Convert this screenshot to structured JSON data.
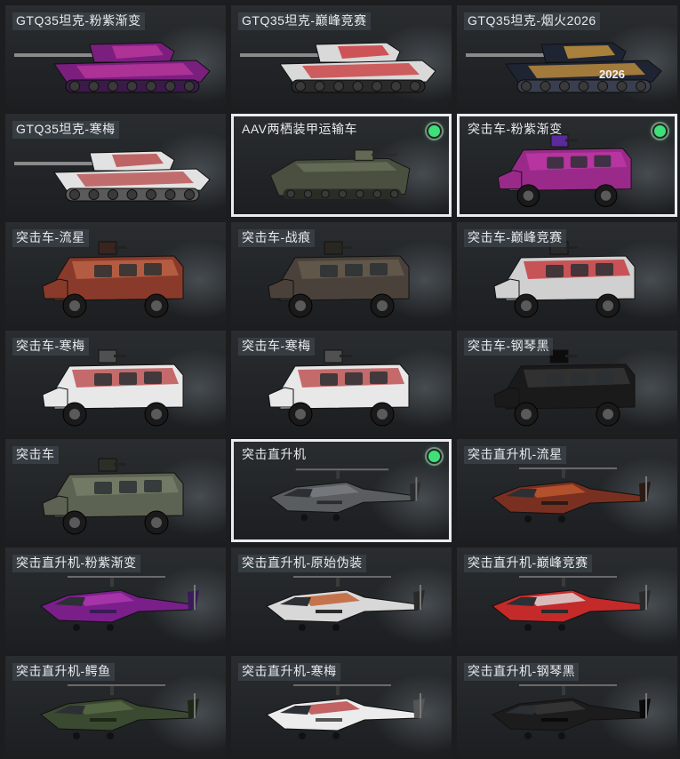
{
  "items": [
    {
      "label": "GTQ35坦克-粉紫渐变",
      "type": "tank",
      "colors": [
        "#7a1f7e",
        "#c23aa0",
        "#3a1a4a"
      ],
      "selected": false,
      "owned": false
    },
    {
      "label": "GTQ35坦克-巅峰竞赛",
      "type": "tank",
      "colors": [
        "#d9d9d9",
        "#c8262a",
        "#2a2a2a"
      ],
      "selected": false,
      "owned": false
    },
    {
      "label": "GTQ35坦克-烟火2026",
      "type": "tank",
      "colors": [
        "#1e2432",
        "#d8a040",
        "#3a3f50"
      ],
      "selected": false,
      "owned": false,
      "decal": "2026"
    },
    {
      "label": "GTQ35坦克-寒梅",
      "type": "tank",
      "colors": [
        "#e2e2e2",
        "#b33a3a",
        "#5a5a5a"
      ],
      "selected": false,
      "owned": false
    },
    {
      "label": "AAV两栖装甲运输车",
      "type": "amphib",
      "colors": [
        "#4a5040",
        "#626a55",
        "#2a2d26"
      ],
      "selected": true,
      "owned": true
    },
    {
      "label": "突击车-粉紫渐变",
      "type": "truck",
      "colors": [
        "#9a2a8a",
        "#c03aa8",
        "#5a2a9a"
      ],
      "selected": true,
      "owned": true
    },
    {
      "label": "突击车-流星",
      "type": "truck",
      "colors": [
        "#8a3a2a",
        "#c2684a",
        "#3a2420"
      ],
      "selected": false,
      "owned": false
    },
    {
      "label": "突击车-战痕",
      "type": "truck",
      "colors": [
        "#4a423a",
        "#6a5e50",
        "#2a2622"
      ],
      "selected": false,
      "owned": false
    },
    {
      "label": "突击车-巅峰竞赛",
      "type": "truck",
      "colors": [
        "#d0d0d0",
        "#c42a2e",
        "#2a2a2a"
      ],
      "selected": false,
      "owned": false
    },
    {
      "label": "突击车-寒梅",
      "type": "truck",
      "colors": [
        "#e8e8e8",
        "#b84040",
        "#505050"
      ],
      "selected": false,
      "owned": false
    },
    {
      "label": "突击车-寒梅",
      "type": "truck",
      "colors": [
        "#e8e8e8",
        "#b84040",
        "#505050"
      ],
      "selected": false,
      "owned": false
    },
    {
      "label": "突击车-钢琴黑",
      "type": "truck",
      "colors": [
        "#1a1a1a",
        "#3a3a3a",
        "#0c0c0c"
      ],
      "selected": false,
      "owned": false
    },
    {
      "label": "突击车",
      "type": "truck",
      "colors": [
        "#5c6352",
        "#7a806c",
        "#2c2f28"
      ],
      "selected": false,
      "owned": false
    },
    {
      "label": "突击直升机",
      "type": "heli",
      "colors": [
        "#5a5d60",
        "#7a7e82",
        "#2a2c2e"
      ],
      "selected": true,
      "owned": true
    },
    {
      "label": "突击直升机-流星",
      "type": "heli",
      "colors": [
        "#7a3020",
        "#c25a30",
        "#2a1a14"
      ],
      "selected": false,
      "owned": false
    },
    {
      "label": "突击直升机-粉紫渐变",
      "type": "heli",
      "colors": [
        "#7a1f8a",
        "#b03ab0",
        "#3a1a5a"
      ],
      "selected": false,
      "owned": false
    },
    {
      "label": "突击直升机-原始伪装",
      "type": "heli",
      "colors": [
        "#d8d8d8",
        "#c05a2a",
        "#2a2a2a"
      ],
      "selected": false,
      "owned": false
    },
    {
      "label": "突击直升机-巅峰竞赛",
      "type": "heli",
      "colors": [
        "#c42a2a",
        "#e0e0e0",
        "#2a2a2a"
      ],
      "selected": false,
      "owned": false
    },
    {
      "label": "突击直升机-鳄鱼",
      "type": "heli",
      "colors": [
        "#3a4a30",
        "#5a6a48",
        "#1e2618"
      ],
      "selected": false,
      "owned": false
    },
    {
      "label": "突击直升机-寒梅",
      "type": "heli",
      "colors": [
        "#ececec",
        "#b84040",
        "#555555"
      ],
      "selected": false,
      "owned": false
    },
    {
      "label": "突击直升机-钢琴黑",
      "type": "heli",
      "colors": [
        "#1c1c1c",
        "#3a3a3a",
        "#0a0a0a"
      ],
      "selected": false,
      "owned": false
    }
  ]
}
